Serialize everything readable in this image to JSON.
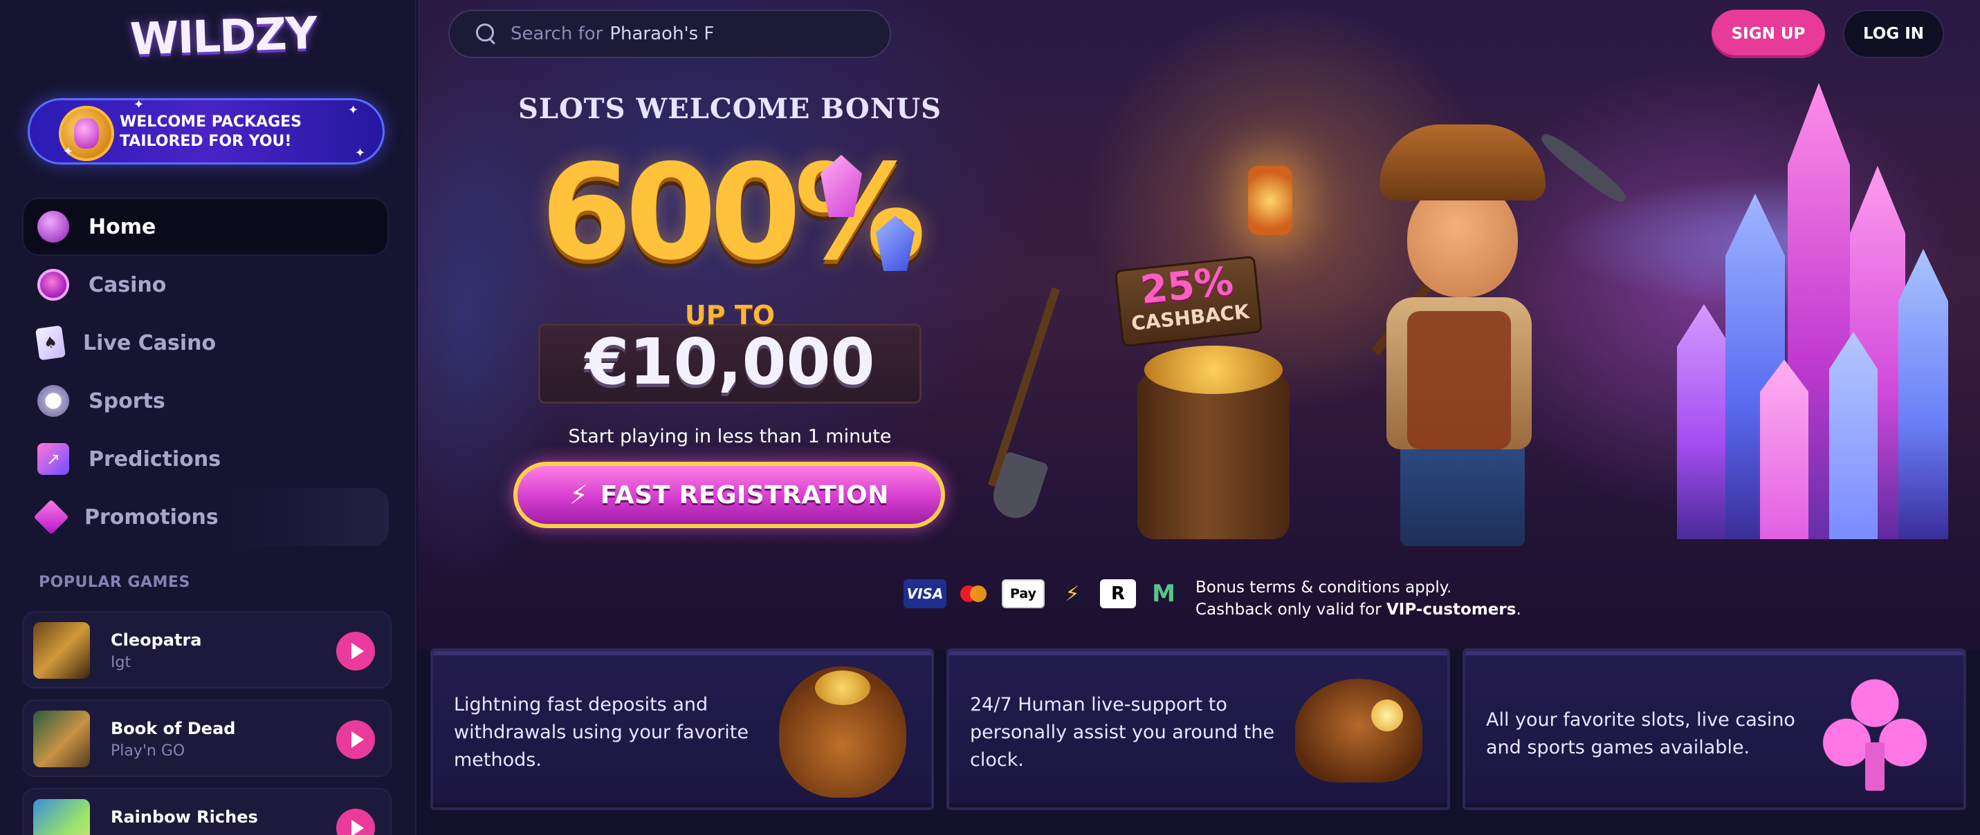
{
  "brand": {
    "logo_text": "WILDZY"
  },
  "sidebar": {
    "welcome_banner": "WELCOME PACKAGES TAILORED FOR YOU!",
    "nav": [
      {
        "label": "Home",
        "icon": "home-icon",
        "active": true
      },
      {
        "label": "Casino",
        "icon": "casino-chip-icon"
      },
      {
        "label": "Live Casino",
        "icon": "playing-cards-icon"
      },
      {
        "label": "Sports",
        "icon": "soccer-ball-icon"
      },
      {
        "label": "Predictions",
        "icon": "chart-trend-icon"
      },
      {
        "label": "Promotions",
        "icon": "diamond-icon"
      }
    ],
    "popular_title": "POPULAR GAMES",
    "games": [
      {
        "name": "Cleopatra",
        "provider": "Igt"
      },
      {
        "name": "Book of Dead",
        "provider": "Play'n GO"
      },
      {
        "name": "Rainbow Riches",
        "provider": ""
      }
    ]
  },
  "header": {
    "search": {
      "prefix": "Search for",
      "value": "Pharaoh's F"
    },
    "signup_label": "SIGN UP",
    "login_label": "LOG IN"
  },
  "hero": {
    "title": "SLOTS WELCOME BONUS",
    "percent": "600%",
    "upto_label": "UP TO",
    "amount": "€10,000",
    "subtitle": "Start playing in less than 1 minute",
    "cta_label": "FAST REGISTRATION",
    "cashback_percent": "25%",
    "cashback_label": "CASHBACK",
    "payments": [
      "VISA",
      "Mastercard",
      "Apple Pay",
      "Lightning",
      "R",
      "M"
    ],
    "payment_labels": {
      "visa": "VISA",
      "apple": "Pay",
      "r": "R",
      "m": "M"
    },
    "terms_line1": "Bonus terms & conditions apply.",
    "terms_line2_prefix": "Cashback only valid for",
    "terms_line2_bold": "VIP-customers",
    "terms_line2_suffix": "."
  },
  "features": [
    {
      "text": "Lightning fast deposits and withdrawals using your favorite methods.",
      "icon": "money-bag-icon"
    },
    {
      "text": "24/7 Human live-support to personally assist you around the clock.",
      "icon": "cowboy-hat-icon"
    },
    {
      "text": "All your favorite slots, live casino and sports games available.",
      "icon": "club-suit-icon"
    }
  ],
  "colors": {
    "accent_pink": "#e83a97",
    "sidebar_bg": "#161431",
    "gold": "#ffc23a"
  }
}
